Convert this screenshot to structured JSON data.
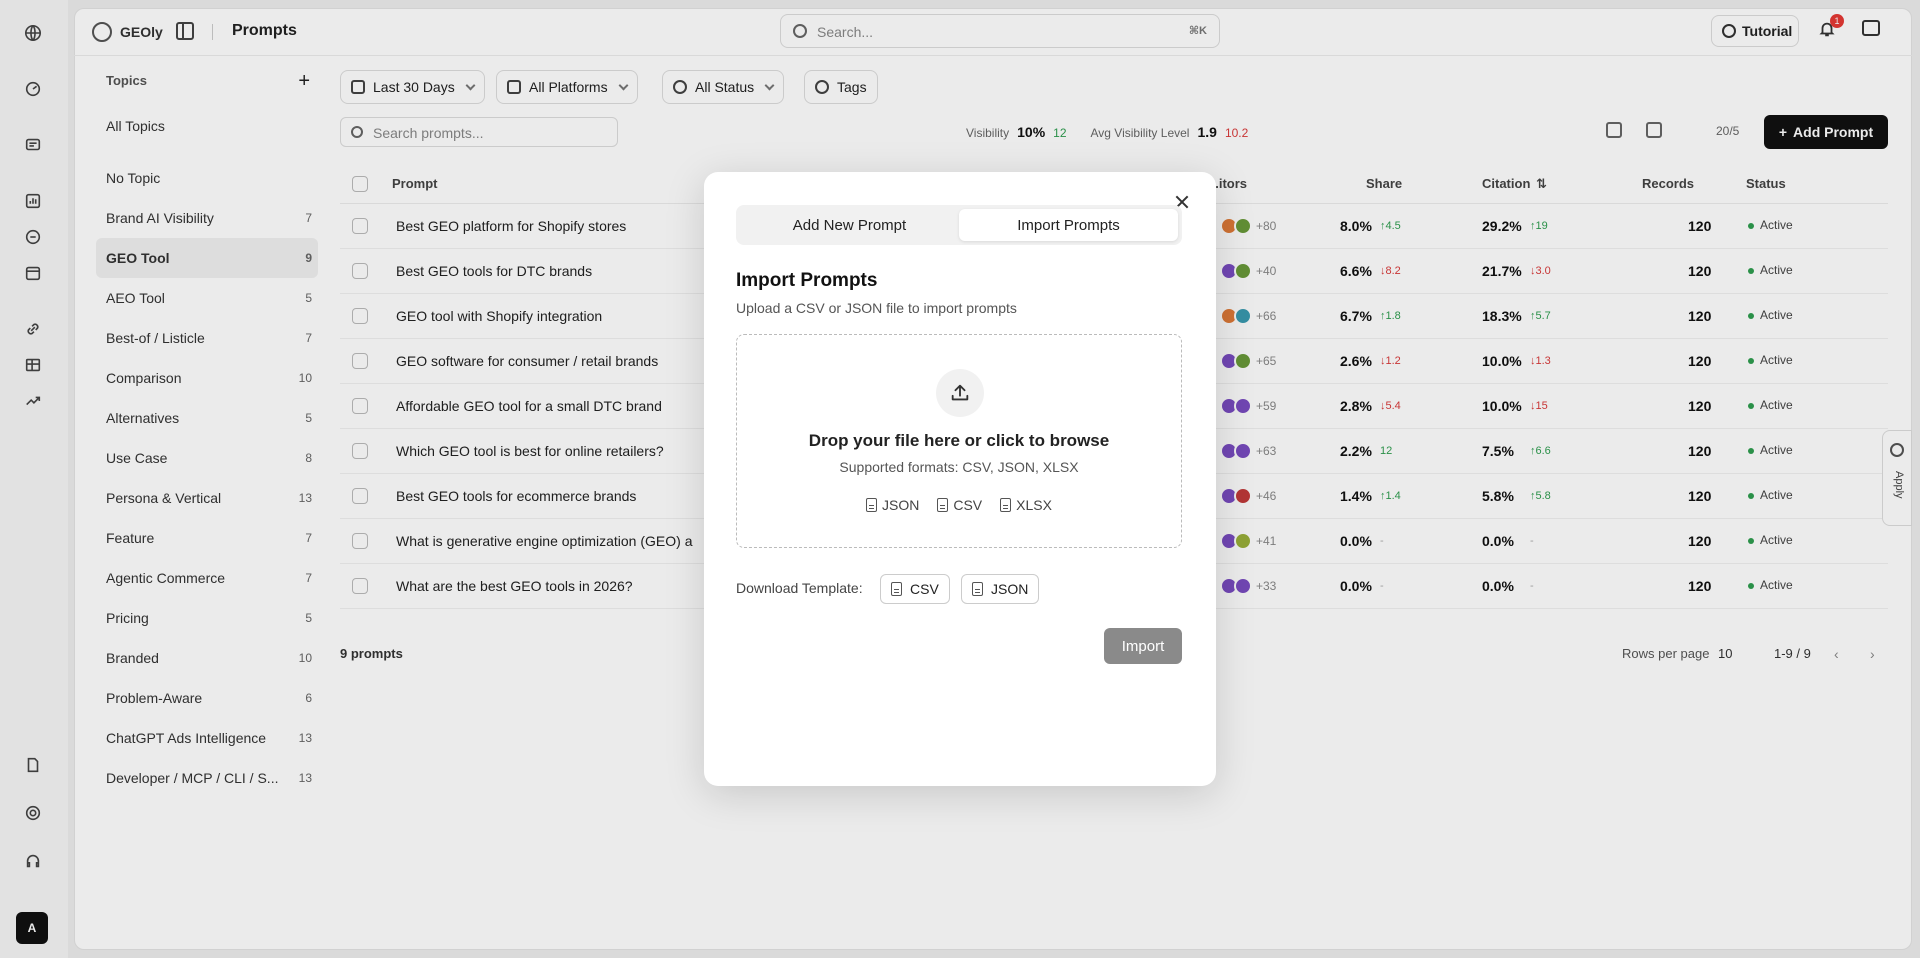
{
  "app": {
    "brand": "GEOly",
    "page_title": "Prompts",
    "search_placeholder": "Search...",
    "search_shortcut": "⌘K",
    "tutorial_label": "Tutorial",
    "notif_count": "1",
    "rail_avatar": "A"
  },
  "topics": {
    "header": "Topics",
    "add": "+",
    "items": [
      {
        "label": "All Topics",
        "count": ""
      },
      {
        "label": "No Topic",
        "count": ""
      },
      {
        "label": "Brand AI Visibility",
        "count": "7"
      },
      {
        "label": "GEO Tool",
        "count": "9"
      },
      {
        "label": "AEO Tool",
        "count": "5"
      },
      {
        "label": "Best-of / Listicle",
        "count": "7"
      },
      {
        "label": "Comparison",
        "count": "10"
      },
      {
        "label": "Alternatives",
        "count": "5"
      },
      {
        "label": "Use Case",
        "count": "8"
      },
      {
        "label": "Persona & Vertical",
        "count": "13"
      },
      {
        "label": "Feature",
        "count": "7"
      },
      {
        "label": "Agentic Commerce",
        "count": "7"
      },
      {
        "label": "Pricing",
        "count": "5"
      },
      {
        "label": "Branded",
        "count": "10"
      },
      {
        "label": "Problem-Aware",
        "count": "6"
      },
      {
        "label": "ChatGPT Ads Intelligence",
        "count": "13"
      },
      {
        "label": "Developer / MCP / CLI / S...",
        "count": "13"
      }
    ]
  },
  "filters": {
    "date": "Last 30 Days",
    "platforms": "All Platforms",
    "status": "All Status",
    "tags": "Tags"
  },
  "toolbar": {
    "search_placeholder": "Search prompts...",
    "visibility_label": "Visibility",
    "visibility_value": "10%",
    "visibility_delta": "12",
    "avg_label": "Avg Visibility Level",
    "avg_value": "1.9",
    "avg_delta": "10.2",
    "page_size": "20/5",
    "add_prompt": "Add Prompt"
  },
  "table": {
    "headers": {
      "prompt": "Prompt",
      "competitors": "...itors",
      "share": "Share",
      "citation": "Citation",
      "records": "Records",
      "status": "Status"
    },
    "rows": [
      {
        "prompt": "Best GEO platform for Shopify stores",
        "comp": "+80",
        "share": "8.0%",
        "sdelta": "↑4.5",
        "sdir": "g",
        "cit": "29.2%",
        "cdelta": "↑19",
        "cdir": "g",
        "rec": "120",
        "status": "Active"
      },
      {
        "prompt": "Best GEO tools for DTC brands",
        "comp": "+40",
        "share": "6.6%",
        "sdelta": "↓8.2",
        "sdir": "r",
        "cit": "21.7%",
        "cdelta": "↓3.0",
        "cdir": "r",
        "rec": "120",
        "status": "Active"
      },
      {
        "prompt": "GEO tool with Shopify integration",
        "comp": "+66",
        "share": "6.7%",
        "sdelta": "↑1.8",
        "sdir": "g",
        "cit": "18.3%",
        "cdelta": "↑5.7",
        "cdir": "g",
        "rec": "120",
        "status": "Active"
      },
      {
        "prompt": "GEO software for consumer / retail brands",
        "comp": "+65",
        "share": "2.6%",
        "sdelta": "↓1.2",
        "sdir": "r",
        "cit": "10.0%",
        "cdelta": "↓1.3",
        "cdir": "r",
        "rec": "120",
        "status": "Active"
      },
      {
        "prompt": "Affordable GEO tool for a small DTC brand",
        "comp": "+59",
        "share": "2.8%",
        "sdelta": "↓5.4",
        "sdir": "r",
        "cit": "10.0%",
        "cdelta": "↓15",
        "cdir": "r",
        "rec": "120",
        "status": "Active"
      },
      {
        "prompt": "Which GEO tool is best for online retailers?",
        "comp": "+63",
        "share": "2.2%",
        "sdelta": "12",
        "sdir": "g",
        "cit": "7.5%",
        "cdelta": "↑6.6",
        "cdir": "g",
        "rec": "120",
        "status": "Active"
      },
      {
        "prompt": "Best GEO tools for ecommerce brands",
        "comp": "+46",
        "share": "1.4%",
        "sdelta": "↑1.4",
        "sdir": "g",
        "cit": "5.8%",
        "cdelta": "↑5.8",
        "cdir": "g",
        "rec": "120",
        "status": "Active"
      },
      {
        "prompt": "What is generative engine optimization (GEO) a",
        "comp": "+41",
        "share": "0.0%",
        "sdelta": "-",
        "sdir": "muted",
        "cit": "0.0%",
        "cdelta": "-",
        "cdir": "muted",
        "rec": "120",
        "status": "Active"
      },
      {
        "prompt": "What are the best GEO tools in 2026?",
        "comp": "+33",
        "share": "0.0%",
        "sdelta": "-",
        "sdir": "muted",
        "cit": "0.0%",
        "cdelta": "-",
        "cdir": "muted",
        "rec": "120",
        "status": "Active"
      }
    ]
  },
  "footer": {
    "count": "9 prompts",
    "rows_per_page": "Rows per page",
    "rows_value": "10",
    "range": "1-9 / 9",
    "prev": "‹",
    "next": "›"
  },
  "feedback": {
    "label": "Apply"
  },
  "modal": {
    "tab_add": "Add New Prompt",
    "tab_import": "Import Prompts",
    "title": "Import Prompts",
    "subtitle": "Upload a CSV or JSON file to import prompts",
    "drop_title": "Drop your file here or click to browse",
    "drop_sub": "Supported formats: CSV, JSON, XLSX",
    "formats": [
      "JSON",
      "CSV",
      "XLSX"
    ],
    "download_label": "Download Template:",
    "dl_csv": "CSV",
    "dl_json": "JSON",
    "import_label": "Import"
  },
  "colors": {
    "accent": "#111111",
    "positive": "#2e9d4f",
    "negative": "#d93a3a",
    "import_disabled": "#8a8a8a"
  }
}
